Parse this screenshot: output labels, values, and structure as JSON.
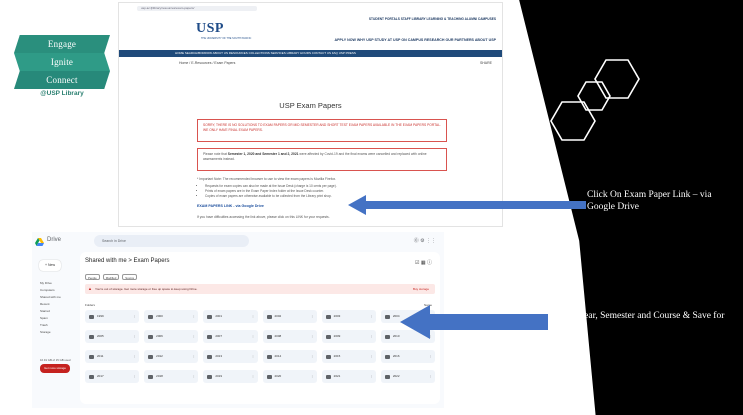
{
  "branding": {
    "ribbons": [
      "Engage",
      "Ignite",
      "Connect"
    ],
    "library_label": "@USP Library"
  },
  "website": {
    "url": "usp.ac.fj/library/resources/exam-papers/",
    "top_links": "STUDENT PORTALS  STAFF  LIBRARY  LEARNING & TEACHING  ALUMNI  CAMPUSES",
    "logo": "USP",
    "logo_sub": "THE UNIVERSITY OF THE SOUTH PACIFIC",
    "main_menu": "APPLY NOW   WHY USP   STUDY AT USP   ON CAMPUS   RESEARCH   OUR PARTNERS   ABOUT USP",
    "nav_strip": "HOME   SEARCH/BORROW   ABOUT US   RESOURCES   COLLECTIONS   SERVICES   LIBRARY HOURS   CONTACT US   FAQ   USP PRESS",
    "breadcrumb": "Home / E-Resources / Exam Papers",
    "share_label": "SHARE",
    "page_title": "USP Exam Papers",
    "notice_1": "SORRY, THERE IS NO SOLUTIONS TO EXAM PAPERS OR MID SEMESTER AND SHORT TEST EXAM PAPERS AVAILABLE IN THE EXAM PAPERS PORTAL. WE ONLY HAVE FINAL EXAM PAPERS.",
    "notice_2_prefix": "Please note that ",
    "notice_2_bold": "Semester 1, 2020 and Semester 1 and 2, 2021",
    "notice_2_suffix": " were affected by Covid-19 and the final exams were cancelled and replaced with online assessments instead.",
    "info_line": "* Important Note: The recommended browser to use to view the exam papers is Mozilla Firefox.",
    "bullets": [
      "Requests for exam copies can also be made at the Issue Desk (charge is 10 cents per page).",
      "Prints of exam papers are in the Exam Paper Index folder at the Issue Desk counter.",
      "Copies of exam papers are otherwise available to be collected from the Library print shop."
    ],
    "exam_link": "EXAM PAPERS LINK - via Google Drive",
    "difficulty_note": "If you have difficulties accessing the link above, please click on this LINK for your requests."
  },
  "drive": {
    "logo_text": "Drive",
    "search_placeholder": "Search in Drive",
    "new_button": "+  New",
    "nav_items": [
      "My Drive",
      "Computers",
      "Shared with me",
      "Recent",
      "Starred",
      "Spam",
      "Trash",
      "Storage"
    ],
    "storage_text": "16.91 GB of 15 GB used",
    "storage_button": "Get more storage",
    "breadcrumb": "Shared with me  >  Exam Papers",
    "chips": [
      "People",
      "Modified",
      "Source"
    ],
    "alert_text": "You're out of storage. Get more storage or free up space to keep using Drive.",
    "alert_action": "Buy storage",
    "folders_label": "Folders",
    "sort_label": "Name",
    "folders": [
      "1999",
      "2000",
      "2001",
      "2002",
      "2003",
      "2004",
      "2005",
      "2006",
      "2007",
      "2008",
      "2009",
      "2010",
      "2011",
      "2012",
      "2013",
      "2014",
      "2015",
      "2016",
      "2017",
      "2018",
      "2019",
      "2020",
      "2021",
      "2022"
    ]
  },
  "callouts": {
    "first": "Click On Exam Paper Link – via Google Drive",
    "second": "Select Year, Semester and Course & Save for viewing"
  },
  "colors": {
    "arrow": "#4472c4",
    "teal": "#2a8f7d",
    "usp_blue": "#1f4a7a"
  }
}
